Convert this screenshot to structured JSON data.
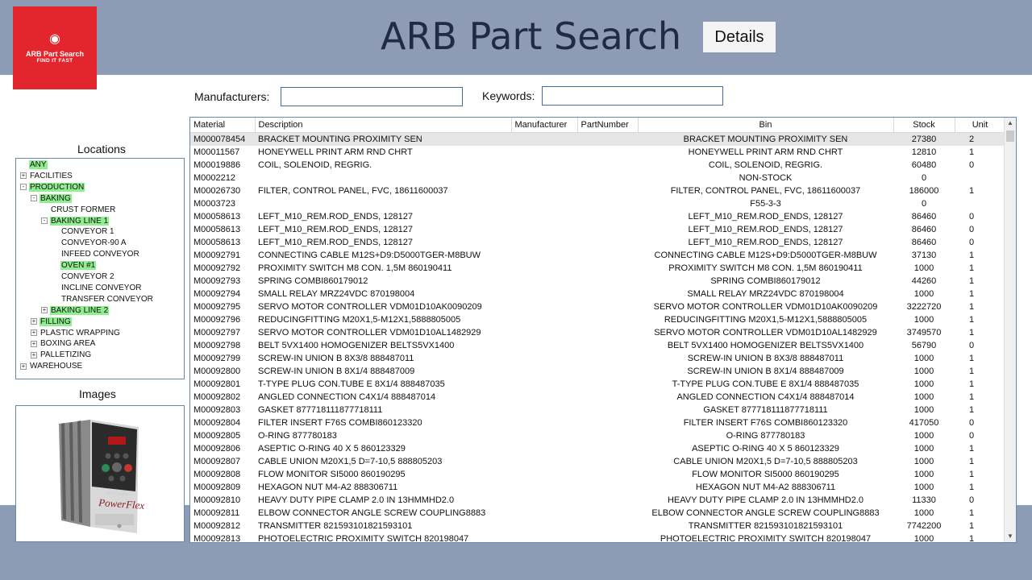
{
  "app": {
    "title": "ARB Part Search",
    "details_label": "Details",
    "logo_line1": "ARB Part Search",
    "logo_line2": "FIND IT FAST"
  },
  "filters": {
    "manufacturers_label": "Manufacturers:",
    "manufacturers_value": "",
    "keywords_label": "Keywords:",
    "keywords_value": ""
  },
  "locations": {
    "title": "Locations",
    "tree": [
      {
        "label": "ANY",
        "depth": 0,
        "expander": "",
        "highlighted": true
      },
      {
        "label": "FACILITIES",
        "depth": 0,
        "expander": "+",
        "highlighted": false
      },
      {
        "label": "PRODUCTION",
        "depth": 0,
        "expander": "-",
        "highlighted": true
      },
      {
        "label": "BAKING",
        "depth": 1,
        "expander": "-",
        "highlighted": true
      },
      {
        "label": "CRUST FORMER",
        "depth": 2,
        "expander": "",
        "highlighted": false
      },
      {
        "label": "BAKING LINE 1",
        "depth": 2,
        "expander": "-",
        "highlighted": true
      },
      {
        "label": "CONVEYOR 1",
        "depth": 3,
        "expander": "",
        "highlighted": false
      },
      {
        "label": "CONVEYOR-90 A",
        "depth": 3,
        "expander": "",
        "highlighted": false
      },
      {
        "label": "INFEED CONVEYOR",
        "depth": 3,
        "expander": "",
        "highlighted": false
      },
      {
        "label": "OVEN #1",
        "depth": 3,
        "expander": "",
        "highlighted": true
      },
      {
        "label": "CONVEYOR 2",
        "depth": 3,
        "expander": "",
        "highlighted": false
      },
      {
        "label": "INCLINE CONVEYOR",
        "depth": 3,
        "expander": "",
        "highlighted": false
      },
      {
        "label": "TRANSFER CONVEYOR",
        "depth": 3,
        "expander": "",
        "highlighted": false
      },
      {
        "label": "BAKING LINE 2",
        "depth": 2,
        "expander": "+",
        "highlighted": true
      },
      {
        "label": "FILLING",
        "depth": 1,
        "expander": "+",
        "highlighted": true
      },
      {
        "label": "PLASTIC WRAPPING",
        "depth": 1,
        "expander": "+",
        "highlighted": false
      },
      {
        "label": "BOXING AREA",
        "depth": 1,
        "expander": "+",
        "highlighted": false
      },
      {
        "label": "PALLETIZING",
        "depth": 1,
        "expander": "+",
        "highlighted": false
      },
      {
        "label": "WAREHOUSE",
        "depth": 0,
        "expander": "+",
        "highlighted": false
      }
    ]
  },
  "images": {
    "title": "Images",
    "brand": "PowerFlex",
    "brand_small": "Allen-Bradley"
  },
  "grid": {
    "columns": [
      "Material",
      "Description",
      "Manufacturer",
      "PartNumber",
      "Bin",
      "Stock",
      "Unit"
    ],
    "rows": [
      [
        "M000078454",
        "BRACKET MOUNTING PROXIMITY SEN",
        "",
        "",
        "BRACKET MOUNTING PROXIMITY SEN",
        "27380",
        "2"
      ],
      [
        "M00011567",
        "HONEYWELL PRINT ARM RND CHRT",
        "",
        "",
        "HONEYWELL PRINT ARM RND CHRT",
        "12810",
        "1"
      ],
      [
        "M00019886",
        "COIL, SOLENOID, REGRIG.",
        "",
        "",
        "COIL, SOLENOID, REGRIG.",
        "60480",
        "0"
      ],
      [
        "M0002212",
        "",
        "",
        "",
        "NON-STOCK",
        "0",
        ""
      ],
      [
        "M00026730",
        "FILTER, CONTROL PANEL, FVC, 18611600037",
        "",
        "",
        "FILTER, CONTROL PANEL, FVC, 18611600037",
        "186000",
        "1"
      ],
      [
        "M0003723",
        "",
        "",
        "",
        "F55-3-3",
        "0",
        ""
      ],
      [
        "M00058613",
        "LEFT_M10_REM.ROD_ENDS, 128127",
        "",
        "",
        "LEFT_M10_REM.ROD_ENDS, 128127",
        "86460",
        "0"
      ],
      [
        "M00058613",
        "LEFT_M10_REM.ROD_ENDS, 128127",
        "",
        "",
        "LEFT_M10_REM.ROD_ENDS, 128127",
        "86460",
        "0"
      ],
      [
        "M00058613",
        "LEFT_M10_REM.ROD_ENDS, 128127",
        "",
        "",
        "LEFT_M10_REM.ROD_ENDS, 128127",
        "86460",
        "0"
      ],
      [
        "M00092791",
        "CONNECTING CABLE M12S+D9:D5000TGER-M8BUW",
        "",
        "",
        "CONNECTING CABLE M12S+D9:D5000TGER-M8BUW",
        "37130",
        "1"
      ],
      [
        "M00092792",
        "PROXIMITY SWITCH M8 CON. 1,5M 860190411",
        "",
        "",
        "PROXIMITY SWITCH M8 CON. 1,5M 860190411",
        "1000",
        "1"
      ],
      [
        "M00092793",
        "SPRING COMBI860179012",
        "",
        "",
        "SPRING COMBI860179012",
        "44260",
        "1"
      ],
      [
        "M00092794",
        "SMALL RELAY MRZ24VDC 870198004",
        "",
        "",
        "SMALL RELAY MRZ24VDC 870198004",
        "1000",
        "1"
      ],
      [
        "M00092795",
        "SERVO MOTOR CONTROLLER VDM01D10AK0090209",
        "",
        "",
        "SERVO MOTOR CONTROLLER VDM01D10AK0090209",
        "3222720",
        "1"
      ],
      [
        "M00092796",
        "REDUCINGFITTING M20X1,5-M12X1,5888805005",
        "",
        "",
        "REDUCINGFITTING M20X1,5-M12X1,5888805005",
        "1000",
        "1"
      ],
      [
        "M00092797",
        "SERVO MOTOR CONTROLLER VDM01D10AL1482929",
        "",
        "",
        "SERVO MOTOR CONTROLLER VDM01D10AL1482929",
        "3749570",
        "1"
      ],
      [
        "M00092798",
        "BELT 5VX1400 HOMOGENIZER BELTS5VX1400",
        "",
        "",
        "BELT 5VX1400 HOMOGENIZER BELTS5VX1400",
        "56790",
        "0"
      ],
      [
        "M00092799",
        "SCREW-IN UNION B 8X3/8 888487011",
        "",
        "",
        "SCREW-IN UNION B 8X3/8 888487011",
        "1000",
        "1"
      ],
      [
        "M00092800",
        "SCREW-IN UNION B 8X1/4 888487009",
        "",
        "",
        "SCREW-IN UNION B 8X1/4 888487009",
        "1000",
        "1"
      ],
      [
        "M00092801",
        "T-TYPE PLUG CON.TUBE E 8X1/4 888487035",
        "",
        "",
        "T-TYPE PLUG CON.TUBE E 8X1/4 888487035",
        "1000",
        "1"
      ],
      [
        "M00092802",
        "ANGLED CONNECTION C4X1/4 888487014",
        "",
        "",
        "ANGLED CONNECTION C4X1/4 888487014",
        "1000",
        "1"
      ],
      [
        "M00092803",
        "GASKET 877718111877718111",
        "",
        "",
        "GASKET 877718111877718111",
        "1000",
        "1"
      ],
      [
        "M00092804",
        "FILTER INSERT F76S COMBI860123320",
        "",
        "",
        "FILTER INSERT F76S COMBI860123320",
        "417050",
        "0"
      ],
      [
        "M00092805",
        "O-RING 877780183",
        "",
        "",
        "O-RING 877780183",
        "1000",
        "0"
      ],
      [
        "M00092806",
        "ASEPTIC O-RING  40 X 5 860123329",
        "",
        "",
        "ASEPTIC O-RING  40 X 5 860123329",
        "1000",
        "1"
      ],
      [
        "M00092807",
        "CABLE UNION M20X1,5 D=7-10,5 888805203",
        "",
        "",
        "CABLE UNION M20X1,5 D=7-10,5 888805203",
        "1000",
        "1"
      ],
      [
        "M00092808",
        "FLOW MONITOR SI5000 860190295",
        "",
        "",
        "FLOW MONITOR SI5000 860190295",
        "1000",
        "1"
      ],
      [
        "M00092809",
        "HEXAGON NUT M4-A2 888306711",
        "",
        "",
        "HEXAGON NUT M4-A2 888306711",
        "1000",
        "1"
      ],
      [
        "M00092810",
        "HEAVY DUTY PIPE CLAMP 2.0 IN 13HMMHD2.0",
        "",
        "",
        "HEAVY DUTY PIPE CLAMP 2.0 IN 13HMMHD2.0",
        "11330",
        "0"
      ],
      [
        "M00092811",
        "ELBOW CONNECTOR ANGLE SCREW COUPLING8883",
        "",
        "",
        "ELBOW CONNECTOR ANGLE SCREW COUPLING8883",
        "1000",
        "1"
      ],
      [
        "M00092812",
        "TRANSMITTER   821593101821593101",
        "",
        "",
        "TRANSMITTER   821593101821593101",
        "7742200",
        "1"
      ],
      [
        "M00092813",
        "PHOTOELECTRIC PROXIMITY SWITCH 820198047",
        "",
        "",
        "PHOTOELECTRIC PROXIMITY SWITCH 820198047",
        "1000",
        "1"
      ]
    ]
  }
}
